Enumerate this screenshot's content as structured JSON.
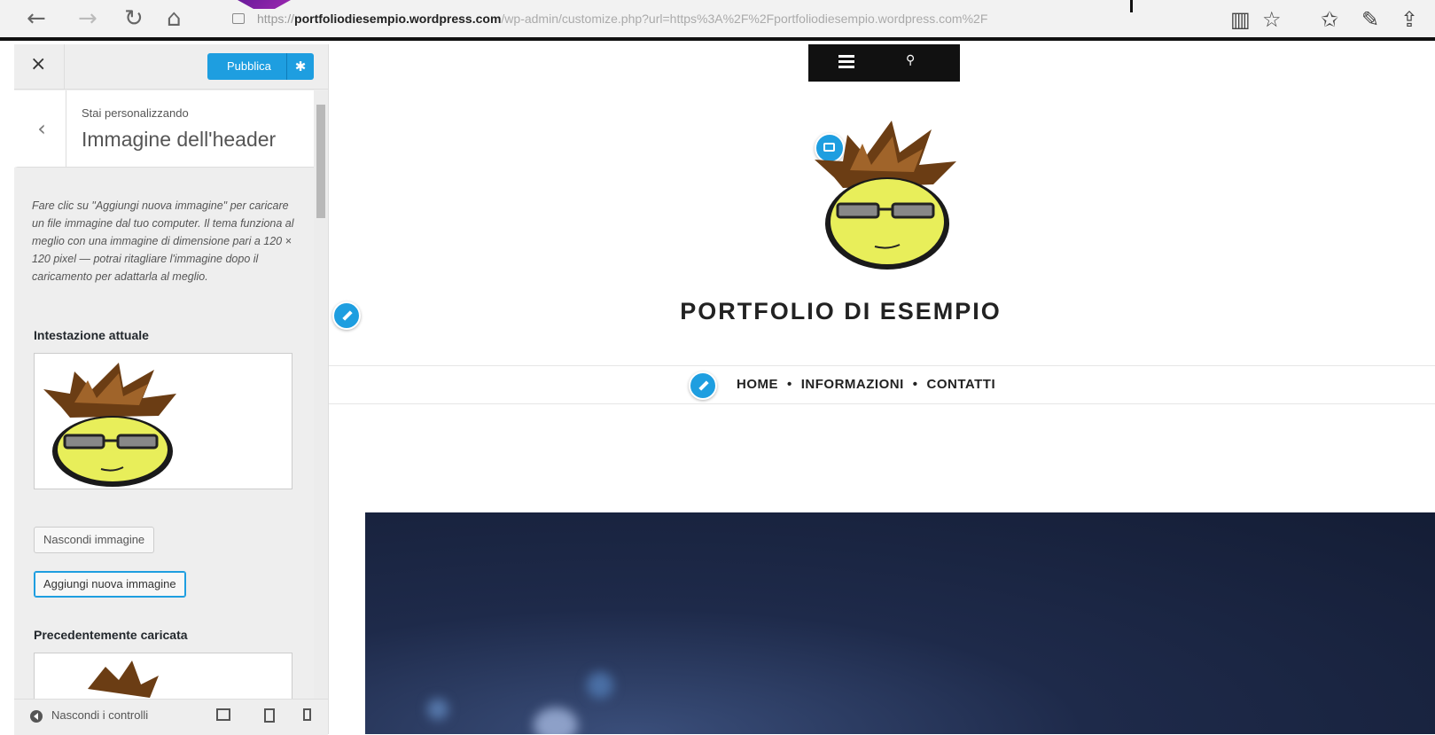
{
  "browser": {
    "back_icon": "←",
    "forward_icon": "→",
    "reload_icon": "↻",
    "home_icon": "⌂",
    "url_host_prefix": "https://",
    "url_host": "portfoliodiesempio.wordpress.com",
    "url_rest": "/wp-admin/customize.php?url=https%3A%2F%2Fportfoliodiesempio.wordpress.com%2F",
    "reading_icon": "▥",
    "favorite_icon": "☆",
    "favorites_icon": "✩",
    "notes_icon": "✎",
    "share_icon": "⇪"
  },
  "customizer": {
    "close_icon": "×",
    "publish_label": "Pubblica",
    "publish_gear": "✱",
    "back_icon": "‹",
    "customizing_label": "Stai personalizzando",
    "section_title": "Immagine dell'header",
    "description": "Fare clic su \"Aggiungi nuova immagine\" per caricare un file immagine dal tuo computer. Il tema funziona al meglio con una immagine di dimensione pari a 120 × 120 pixel — potrai ritagliare l'immagine dopo il caricamento per adattarla al meglio.",
    "current_header_label": "Intestazione attuale",
    "hide_image_label": "Nascondi immagine",
    "add_image_label": "Aggiungi nuova immagine",
    "previous_label": "Precedentemente caricata",
    "hide_controls_label": "Nascondi i controlli"
  },
  "preview": {
    "site_title": "PORTFOLIO DI ESEMPIO",
    "menu": [
      "HOME",
      "INFORMAZIONI",
      "CONTATTI"
    ],
    "menu_separator": "•",
    "search_icon": "⚲"
  },
  "colors": {
    "accent": "#1e9ee0",
    "hero_dark": "#141d35"
  }
}
